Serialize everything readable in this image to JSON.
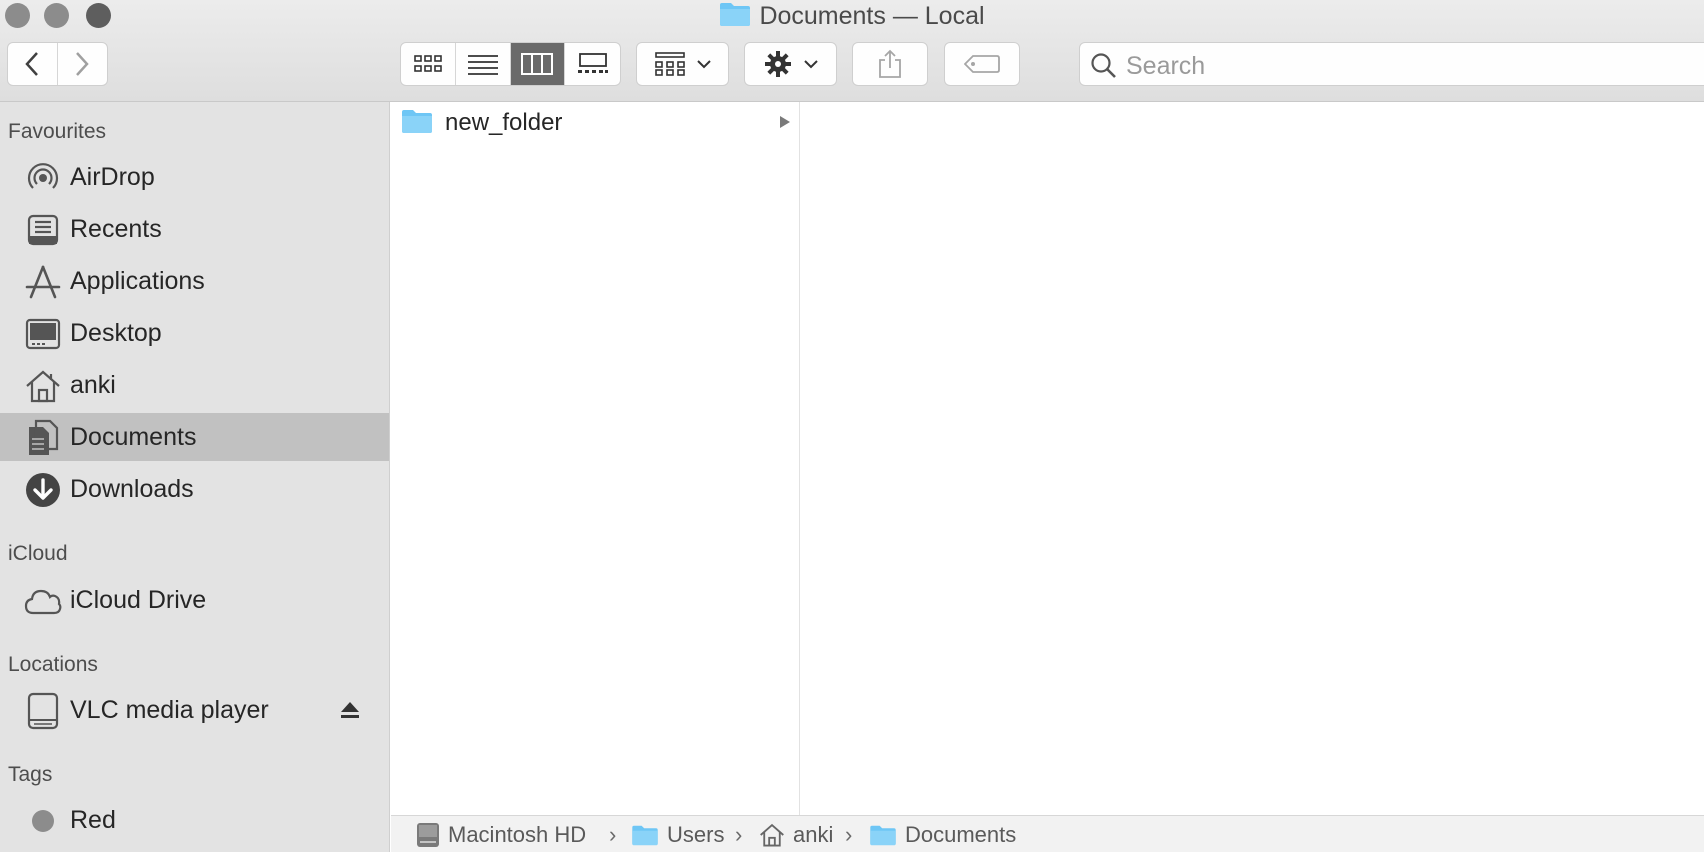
{
  "window": {
    "title": "Documents — Local"
  },
  "toolbar": {
    "search_placeholder": "Search"
  },
  "sidebar": {
    "favourites_heading": "Favourites",
    "icloud_heading": "iCloud",
    "locations_heading": "Locations",
    "tags_heading": "Tags",
    "favourites": [
      {
        "label": "AirDrop",
        "icon": "airdrop-icon"
      },
      {
        "label": "Recents",
        "icon": "recents-icon"
      },
      {
        "label": "Applications",
        "icon": "applications-icon"
      },
      {
        "label": "Desktop",
        "icon": "desktop-icon"
      },
      {
        "label": "anki",
        "icon": "home-icon"
      },
      {
        "label": "Documents",
        "icon": "documents-icon",
        "selected": true
      },
      {
        "label": "Downloads",
        "icon": "downloads-icon"
      }
    ],
    "icloud": [
      {
        "label": "iCloud Drive",
        "icon": "cloud-icon"
      }
    ],
    "locations": [
      {
        "label": "VLC media player",
        "icon": "disk-icon"
      }
    ],
    "tags": [
      {
        "label": "Red",
        "color": "#8c8c8c"
      }
    ]
  },
  "browser": {
    "items": [
      {
        "name": "new_folder",
        "type": "folder"
      }
    ]
  },
  "pathbar": {
    "items": [
      "Macintosh HD",
      "Users",
      "anki",
      "Documents"
    ]
  },
  "colors": {
    "folder": "#6ec6f5",
    "selection": "#c1c1c1"
  }
}
